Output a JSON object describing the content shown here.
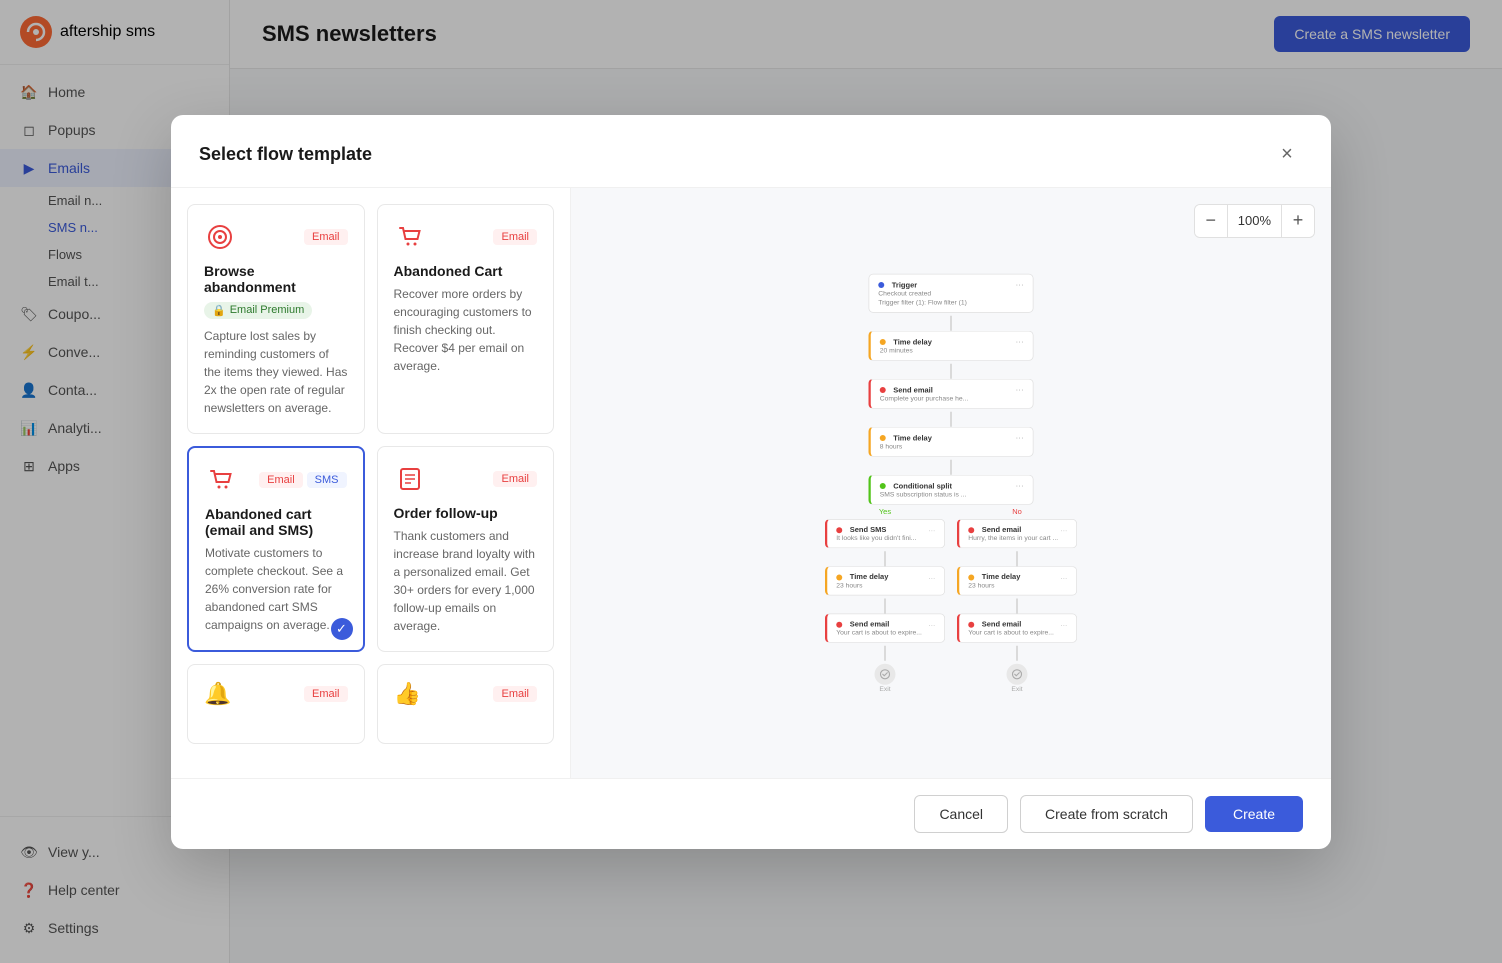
{
  "app": {
    "name": "aftership sms"
  },
  "sidebar": {
    "nav_items": [
      {
        "id": "home",
        "label": "Home",
        "icon": "home-icon"
      },
      {
        "id": "popups",
        "label": "Popups",
        "icon": "popup-icon"
      },
      {
        "id": "emails",
        "label": "Emails",
        "icon": "email-icon",
        "active": true
      }
    ],
    "sub_items": [
      {
        "id": "email-newsletters",
        "label": "Email n..."
      },
      {
        "id": "sms-newsletters",
        "label": "SMS n..."
      },
      {
        "id": "flows",
        "label": "Flows"
      },
      {
        "id": "email-t",
        "label": "Email t..."
      }
    ],
    "other_items": [
      {
        "id": "coupons",
        "label": "Coupo..."
      },
      {
        "id": "conversions",
        "label": "Conve..."
      },
      {
        "id": "contacts",
        "label": "Conta..."
      },
      {
        "id": "analytics",
        "label": "Analyti..."
      },
      {
        "id": "apps",
        "label": "Apps"
      }
    ],
    "bottom_items": [
      {
        "id": "view-your",
        "label": "View y..."
      },
      {
        "id": "help-center",
        "label": "Help center"
      },
      {
        "id": "settings",
        "label": "Settings"
      }
    ]
  },
  "main": {
    "title": "SMS newsletters",
    "create_button": "Create a SMS newsletter"
  },
  "modal": {
    "title": "Select flow template",
    "close_label": "×",
    "zoom": {
      "minus": "−",
      "value": "100%",
      "plus": "+"
    },
    "templates": [
      {
        "id": "browse-abandonment",
        "name": "Browse abandonment",
        "tags": [
          "Email"
        ],
        "premium": true,
        "premium_label": "Email Premium",
        "description": "Capture lost sales by reminding customers of the items they viewed. Has 2x the open rate of regular newsletters on average.",
        "icon": "target-icon",
        "selected": false
      },
      {
        "id": "abandoned-cart",
        "name": "Abandoned Cart",
        "tags": [
          "Email"
        ],
        "premium": false,
        "description": "Recover more orders by encouraging customers to finish checking out. Recover $4 per email on average.",
        "icon": "cart-icon",
        "selected": false
      },
      {
        "id": "abandoned-cart-email-sms",
        "name": "Abandoned cart (email and SMS)",
        "tags": [
          "Email",
          "SMS"
        ],
        "premium": false,
        "description": "Motivate customers to complete checkout. See a 26% conversion rate for abandoned cart SMS campaigns on average.",
        "icon": "cart-sms-icon",
        "selected": true
      },
      {
        "id": "order-followup",
        "name": "Order follow-up",
        "tags": [
          "Email"
        ],
        "premium": false,
        "description": "Thank customers and increase brand loyalty with a personalized email. Get 30+ orders for every 1,000 follow-up emails on average.",
        "icon": "order-icon",
        "selected": false
      }
    ],
    "more_templates": [
      {
        "id": "t5",
        "icon": "bell-icon",
        "tags": [
          "Email"
        ]
      },
      {
        "id": "t6",
        "icon": "thumb-icon",
        "tags": [
          "Email"
        ]
      }
    ],
    "footer": {
      "cancel_label": "Cancel",
      "create_scratch_label": "Create from scratch",
      "create_label": "Create"
    }
  },
  "flow_diagram": {
    "nodes": [
      {
        "type": "trigger",
        "title": "Trigger",
        "sub": "Checkout created",
        "dot": "blue"
      },
      {
        "type": "delay",
        "title": "Time delay",
        "sub": "20 minutes",
        "dot": "orange"
      },
      {
        "type": "send-email",
        "title": "Send email",
        "sub": "Complete your purchase he...",
        "dot": "red"
      },
      {
        "type": "delay",
        "title": "Time delay",
        "sub": "8 hours",
        "dot": "orange"
      },
      {
        "type": "conditional",
        "title": "Conditional split",
        "sub": "SMS subscription status is ...",
        "dot": "green"
      }
    ],
    "branches": [
      {
        "label": "Yes",
        "nodes": [
          {
            "type": "send-sms",
            "title": "Send SMS",
            "sub": "It looks like you didn't fini...",
            "dot": "red"
          },
          {
            "type": "delay",
            "title": "Time delay",
            "sub": "23 hours",
            "dot": "orange"
          },
          {
            "type": "send-email",
            "title": "Send email",
            "sub": "Your cart is about to expire...",
            "dot": "red"
          }
        ]
      },
      {
        "label": "No",
        "nodes": [
          {
            "type": "send-email",
            "title": "Send email",
            "sub": "Hurry, the items in your cart ...",
            "dot": "red"
          },
          {
            "type": "delay",
            "title": "Time delay",
            "sub": "23 hours",
            "dot": "orange"
          },
          {
            "type": "send-email",
            "title": "Send email",
            "sub": "Your cart is about to expire...",
            "dot": "red"
          }
        ]
      }
    ]
  }
}
